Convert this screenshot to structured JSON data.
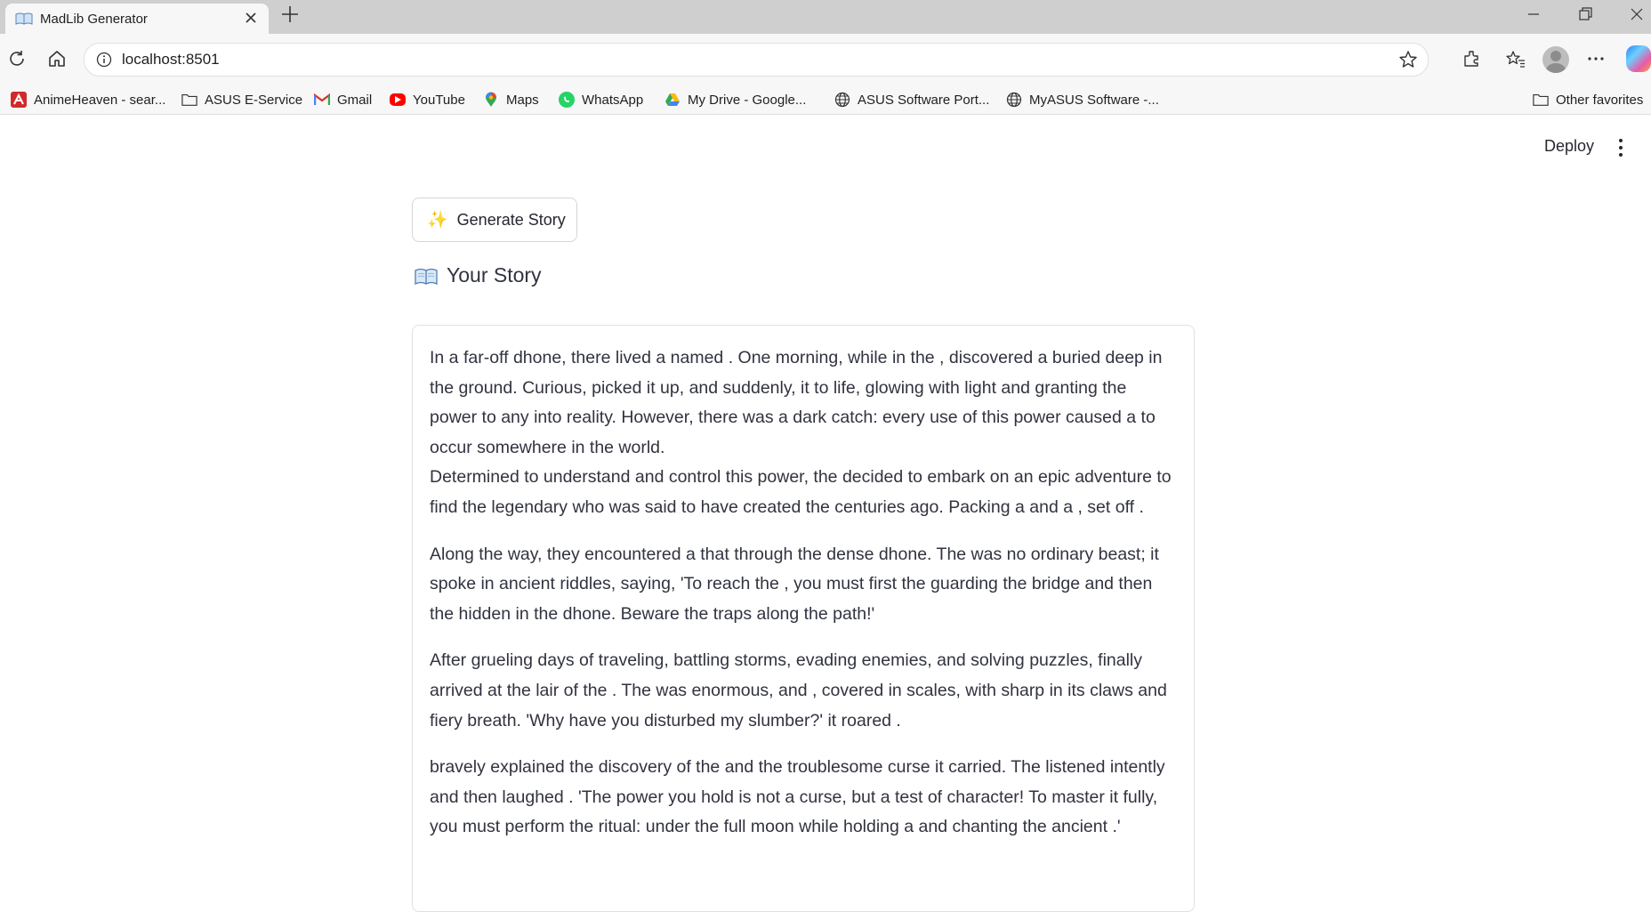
{
  "browser": {
    "tab_title": "MadLib Generator",
    "url": "localhost:8501",
    "bookmarks": [
      "AnimeHeaven - sear...",
      "ASUS E-Service",
      "Gmail",
      "YouTube",
      "Maps",
      "WhatsApp",
      "My Drive - Google...",
      "ASUS Software Port...",
      "MyASUS Software -..."
    ],
    "other_favorites": "Other favorites"
  },
  "app": {
    "deploy_label": "Deploy",
    "generate_button": "Generate Story",
    "story_heading": "Your Story",
    "story_paragraphs": [
      "In a far-off dhone, there lived a named . One morning, while in the , discovered a buried deep in the ground. Curious, picked it up, and suddenly, it to life, glowing with light and granting the power to any into reality. However, there was a dark catch: every use of this power caused a to occur somewhere in the world.",
      "Determined to understand and control this power, the decided to embark on an epic adventure to find the legendary who was said to have created the centuries ago. Packing a and a , set off .",
      "Along the way, they encountered a that through the dense dhone. The was no ordinary beast; it spoke in ancient riddles, saying, 'To reach the , you must first the guarding the bridge and then the hidden in the dhone. Beware the traps along the path!'",
      "After grueling days of traveling, battling storms, evading enemies, and solving puzzles, finally arrived at the lair of the . The was enormous, and , covered in scales, with sharp in its claws and fiery breath. 'Why have you disturbed my slumber?' it roared .",
      "bravely explained the discovery of the and the troublesome curse it carried. The listened intently and then laughed . 'The power you hold is not a curse, but a test of character! To master it fully, you must perform the ritual: under the full moon while holding a and chanting the ancient .'"
    ]
  }
}
